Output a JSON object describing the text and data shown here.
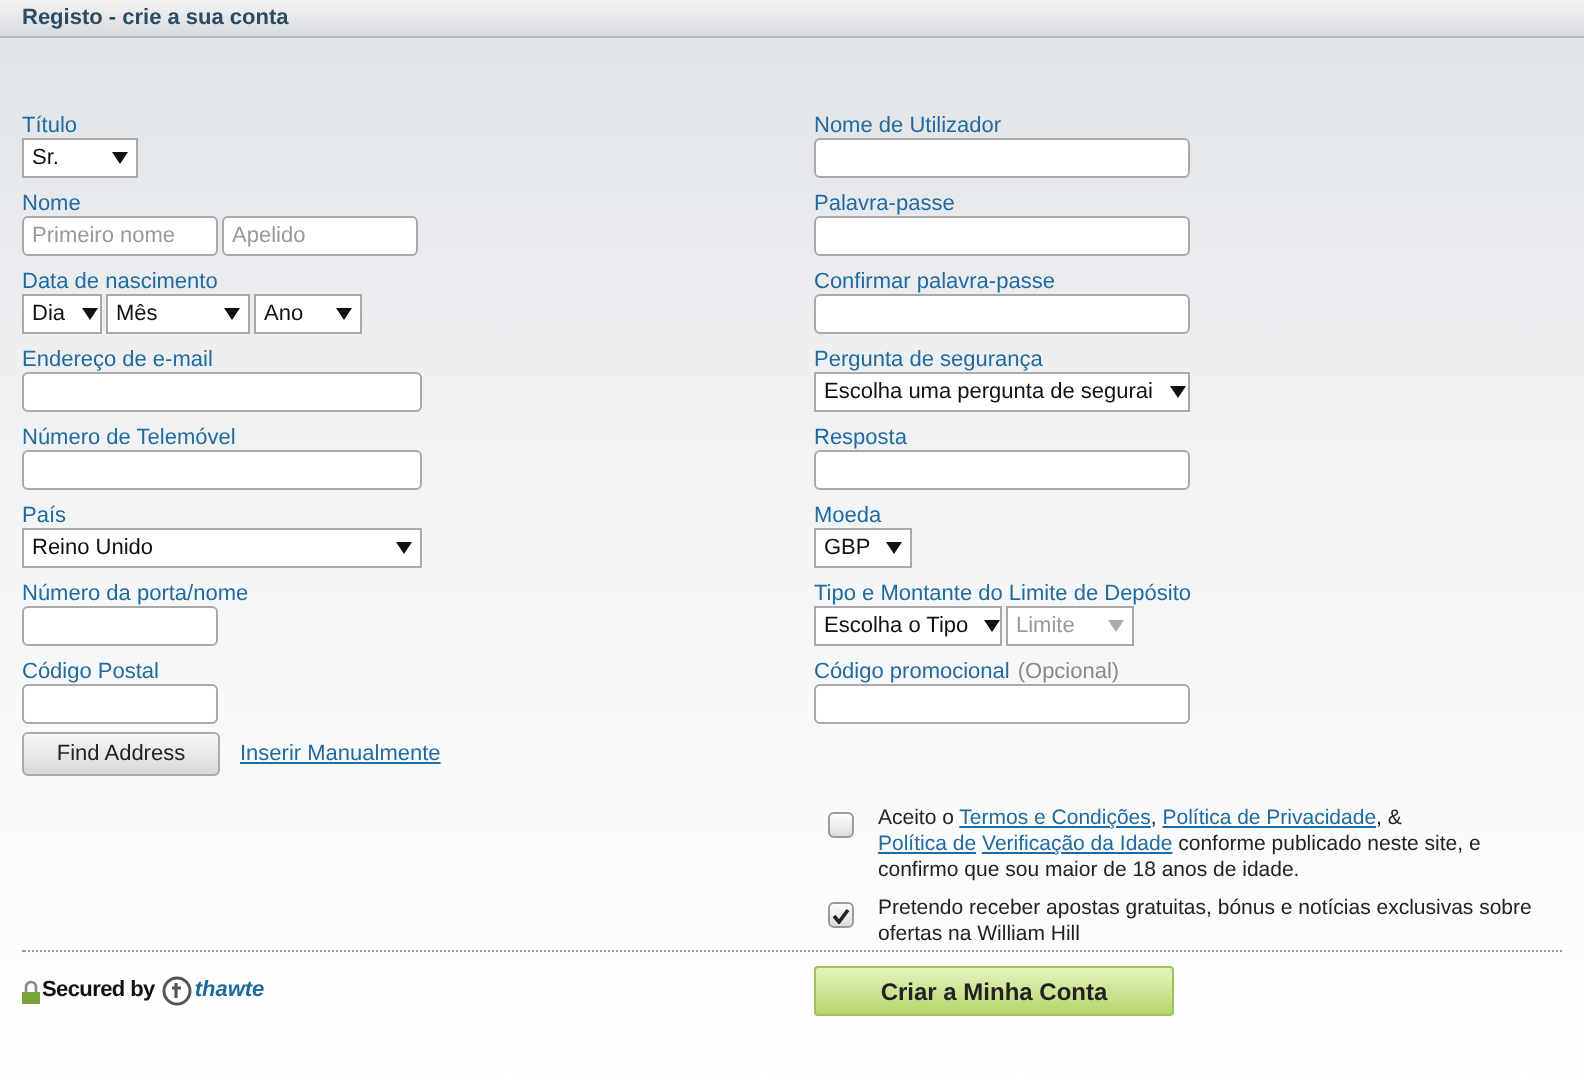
{
  "header": {
    "title": "Registo - crie a sua conta"
  },
  "left_fields": [
    {
      "label": "Título",
      "kind": "compact_select",
      "controls": [
        {
          "kind": "select",
          "value": "Sr.",
          "disabled": false
        }
      ]
    },
    {
      "label": "Nome",
      "kind": "pair",
      "controls": [
        {
          "kind": "input",
          "placeholder": "Primeiro nome"
        },
        {
          "kind": "input",
          "placeholder": "Apelido"
        }
      ]
    },
    {
      "label": "Data de nascimento",
      "kind": "date",
      "controls": [
        {
          "kind": "select",
          "value": "Dia",
          "disabled": false
        },
        {
          "kind": "select",
          "value": "Mês",
          "disabled": false
        },
        {
          "kind": "select",
          "value": "Ano",
          "disabled": false
        }
      ]
    },
    {
      "label": "Endereço de e-mail",
      "kind": "wide",
      "controls": [
        {
          "kind": "input"
        }
      ]
    },
    {
      "label": "Número de Telemóvel",
      "kind": "wide",
      "controls": [
        {
          "kind": "input"
        }
      ]
    },
    {
      "label": "País",
      "kind": "wide",
      "controls": [
        {
          "kind": "select",
          "value": "Reino Unido",
          "disabled": false
        }
      ]
    },
    {
      "label": "Número da porta/nome",
      "kind": "short",
      "controls": [
        {
          "kind": "input"
        }
      ]
    },
    {
      "label": "Código Postal",
      "kind": "short",
      "controls": [
        {
          "kind": "input"
        }
      ]
    }
  ],
  "find_address": {
    "button": "Find Address",
    "link": "Inserir Manualmente"
  },
  "right_fields": [
    {
      "label": "Nome de Utilizador",
      "kind": "wide",
      "controls": [
        {
          "kind": "input"
        }
      ]
    },
    {
      "label": "Palavra-passe",
      "kind": "wide",
      "controls": [
        {
          "kind": "input"
        }
      ]
    },
    {
      "label": "Confirmar palavra-passe",
      "kind": "wide",
      "controls": [
        {
          "kind": "input"
        }
      ]
    },
    {
      "label": "Pergunta de segurança",
      "kind": "wide",
      "controls": [
        {
          "kind": "select",
          "value": "Escolha uma pergunta de segurai",
          "disabled": false
        }
      ]
    },
    {
      "label": "Resposta",
      "kind": "wide",
      "controls": [
        {
          "kind": "input"
        }
      ]
    },
    {
      "label": "Moeda",
      "kind": "compact_select",
      "controls": [
        {
          "kind": "select",
          "value": "GBP",
          "disabled": false
        }
      ]
    },
    {
      "label": "Tipo e Montante do Limite de Depósito",
      "kind": "pair_select",
      "controls": [
        {
          "kind": "select",
          "value": "Escolha o Tipo",
          "disabled": false
        },
        {
          "kind": "select",
          "value": "Limite",
          "disabled": true
        }
      ]
    },
    {
      "label": "Código promocional",
      "note": "(Opcional)",
      "kind": "wide",
      "controls": [
        {
          "kind": "input"
        }
      ]
    }
  ],
  "agreements": [
    {
      "checked": false,
      "parts": [
        {
          "text": "Aceito o ",
          "kind": "plain"
        },
        {
          "text": "Termos e Condições",
          "kind": "link"
        },
        {
          "text": ", ",
          "kind": "plain"
        },
        {
          "text": "Política de Privacidade",
          "kind": "link"
        },
        {
          "text": ", & ",
          "kind": "plain"
        },
        {
          "text": "Política de",
          "kind": "link"
        },
        {
          "text": "Verificação da Idade",
          "kind": "link"
        },
        {
          "text": " conforme publicado neste site, e confirmo que sou maior de 18 anos de idade.",
          "kind": "plain"
        }
      ]
    },
    {
      "checked": true,
      "parts": [
        {
          "text": "Pretendo receber apostas gratuitas, bónus e notícias exclusivas sobre ofertas na William Hill",
          "kind": "plain"
        }
      ]
    }
  ],
  "footer": {
    "secured": "Secured by",
    "brand": "thawte",
    "submit": "Criar a Minha Conta"
  }
}
